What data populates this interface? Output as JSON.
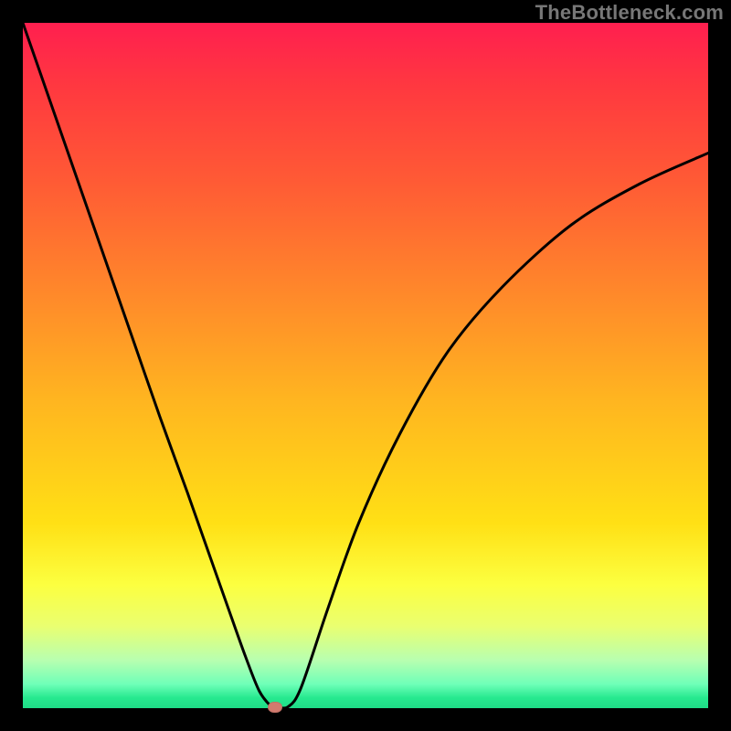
{
  "watermark": "TheBottleneck.com",
  "colors": {
    "page_bg": "#000000",
    "curve_stroke": "#000000",
    "marker_fill": "#d17a6e",
    "gradient_top": "#ff1f4f",
    "gradient_bottom": "#1fdc87"
  },
  "chart_data": {
    "type": "line",
    "title": "",
    "xlabel": "",
    "ylabel": "",
    "xlim": [
      0,
      100
    ],
    "ylim": [
      0,
      100
    ],
    "grid": false,
    "legend": false,
    "x": [
      0,
      4,
      8,
      12,
      16,
      20,
      24,
      27,
      30,
      32.5,
      34.5,
      36.3,
      37,
      38.7,
      40.6,
      44.5,
      49,
      55,
      62,
      70,
      80,
      90,
      100
    ],
    "values": [
      100,
      88.5,
      77,
      65.5,
      54,
      42.5,
      31.5,
      23,
      14.5,
      7.5,
      2.5,
      0.2,
      0.2,
      0.2,
      3,
      14.5,
      27,
      40,
      52,
      61.5,
      70.5,
      76.5,
      81
    ],
    "note": "Values approximate a V-shaped bottleneck curve with its minimum near x≈36–38; left branch is near-linear, right branch is concave (diminishing slope). A small marker sits at the curve's minimum.",
    "marker": {
      "x": 36.8,
      "y": 0.2
    }
  }
}
